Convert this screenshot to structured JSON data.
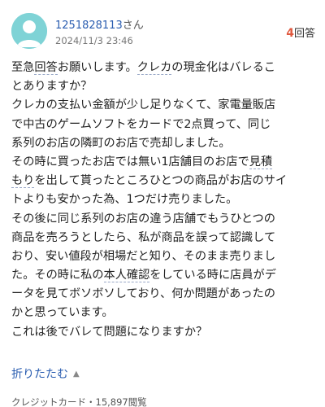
{
  "header": {
    "user_name": "1251828113",
    "honorific": "さん",
    "post_date": "2024/11/3 23:46",
    "answer_count": "4",
    "answer_suffix": "回答",
    "avatar_icon": "default-user-avatar-icon"
  },
  "question": {
    "lines": [
      [
        "至急",
        {
          "kw": "回答"
        },
        "お願いします。",
        {
          "kw": "クレカ"
        },
        "の現金化はバレるこ"
      ],
      [
        "とありますか？"
      ],
      [
        "クレカの支払い金額が少し足りなくて、家電量販店"
      ],
      [
        "で中古のゲームソフトをカードで2点買って、同じ"
      ],
      [
        "系列のお店の隣町のお店で売却しました。"
      ],
      [
        "その時に買ったお店では無い1店舗目のお店で",
        {
          "kw": "見積"
        }
      ],
      [
        {
          "kw": "もり"
        },
        "を出して貰ったところひとつの商品がお店のサイ"
      ],
      [
        "トよりも安かった為、1つだけ売りました。"
      ],
      [
        "その後に同じ系列のお店の違う店舗でもうひとつの"
      ],
      [
        "商品を売ろうとしたら、私が商品を誤って認識して"
      ],
      [
        "おり、安い値段が相場だと知り、そのまま売りまし"
      ],
      [
        "た。その時に私の",
        {
          "kw": "本人確認"
        },
        "をしている時に店員がデ"
      ],
      [
        "ータを見てボソボソしており、何か問題があったの"
      ],
      [
        "かと思っています。"
      ],
      [
        "これは後でバレて問題になりますか？"
      ]
    ]
  },
  "collapse": {
    "label": "折りたたむ",
    "icon": "caret-up-icon"
  },
  "footer": {
    "category_views": "クレジットカード・15,897閲覧"
  },
  "colors": {
    "link": "#2a5db0",
    "answer_count": "#e0593f",
    "avatar_bg": "#7fd3d6"
  }
}
